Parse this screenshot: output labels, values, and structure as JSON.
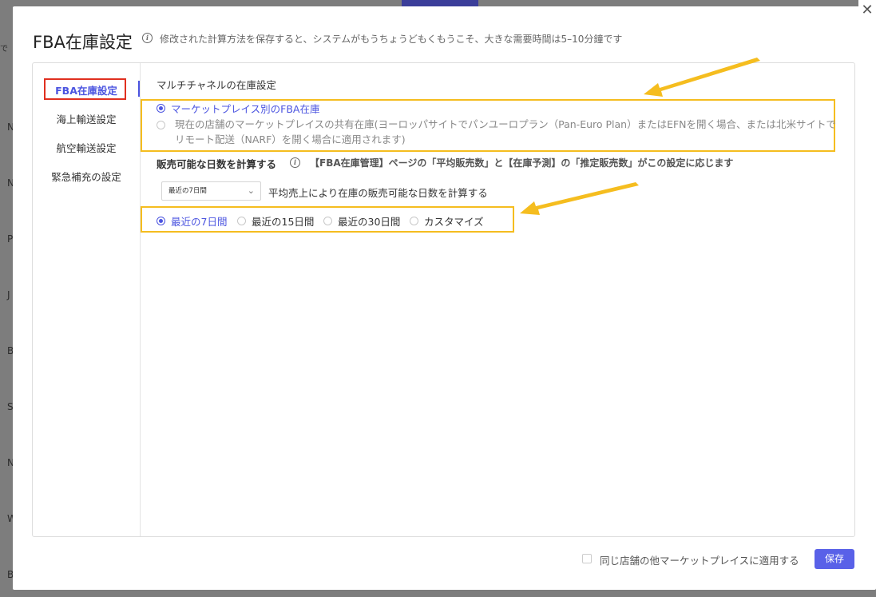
{
  "background": {
    "row_letters": [
      "N",
      "N",
      "P",
      "J",
      "B",
      "S",
      "N",
      "W",
      "B"
    ],
    "top_left_text": "で"
  },
  "modal": {
    "title": "FBA在庫設定",
    "note": "修改された計算方法を保存すると、システムがもうちょうどもくもうこそ、大きな需要時間は5–10分鐘です",
    "close_symbol": "✕"
  },
  "sidebar": {
    "items": [
      {
        "label": "FBA在庫設定",
        "active": true
      },
      {
        "label": "海上輸送設定",
        "active": false
      },
      {
        "label": "航空輸送設定",
        "active": false
      },
      {
        "label": "緊急補充の設定",
        "active": false
      }
    ]
  },
  "multichannel": {
    "title": "マルチチャネルの在庫設定",
    "options": [
      {
        "label": "マーケットプレイス別のFBA在庫",
        "checked": true
      },
      {
        "label": "現在の店舗のマーケットプレイスの共有在庫(ヨーロッパサイトでパンユーロプラン（Pan-Euro Plan）またはEFNを開く場合、または北米サイトでリモート配送（NARF）を開く場合に適用されます)",
        "checked": false
      }
    ]
  },
  "sellable_days": {
    "title": "販売可能な日数を計算する",
    "note": "【FBA在庫管理】ページの「平均販売数」と【在庫予測】の「推定販売数」がこの設定に応じます",
    "select_value": "最近の7日間",
    "select_desc": "平均売上により在庫の販売可能な日数を計算する",
    "options": [
      {
        "label": "最近の7日間",
        "checked": true
      },
      {
        "label": "最近の15日間",
        "checked": false
      },
      {
        "label": "最近の30日間",
        "checked": false
      },
      {
        "label": "カスタマイズ",
        "checked": false
      }
    ]
  },
  "footer": {
    "apply_label": "同じ店舗の他マーケットプレイスに適用する",
    "save_label": "保存"
  },
  "colors": {
    "accent": "#4b54e0",
    "highlight": "#f5bd1f",
    "active_box": "#e03020"
  }
}
